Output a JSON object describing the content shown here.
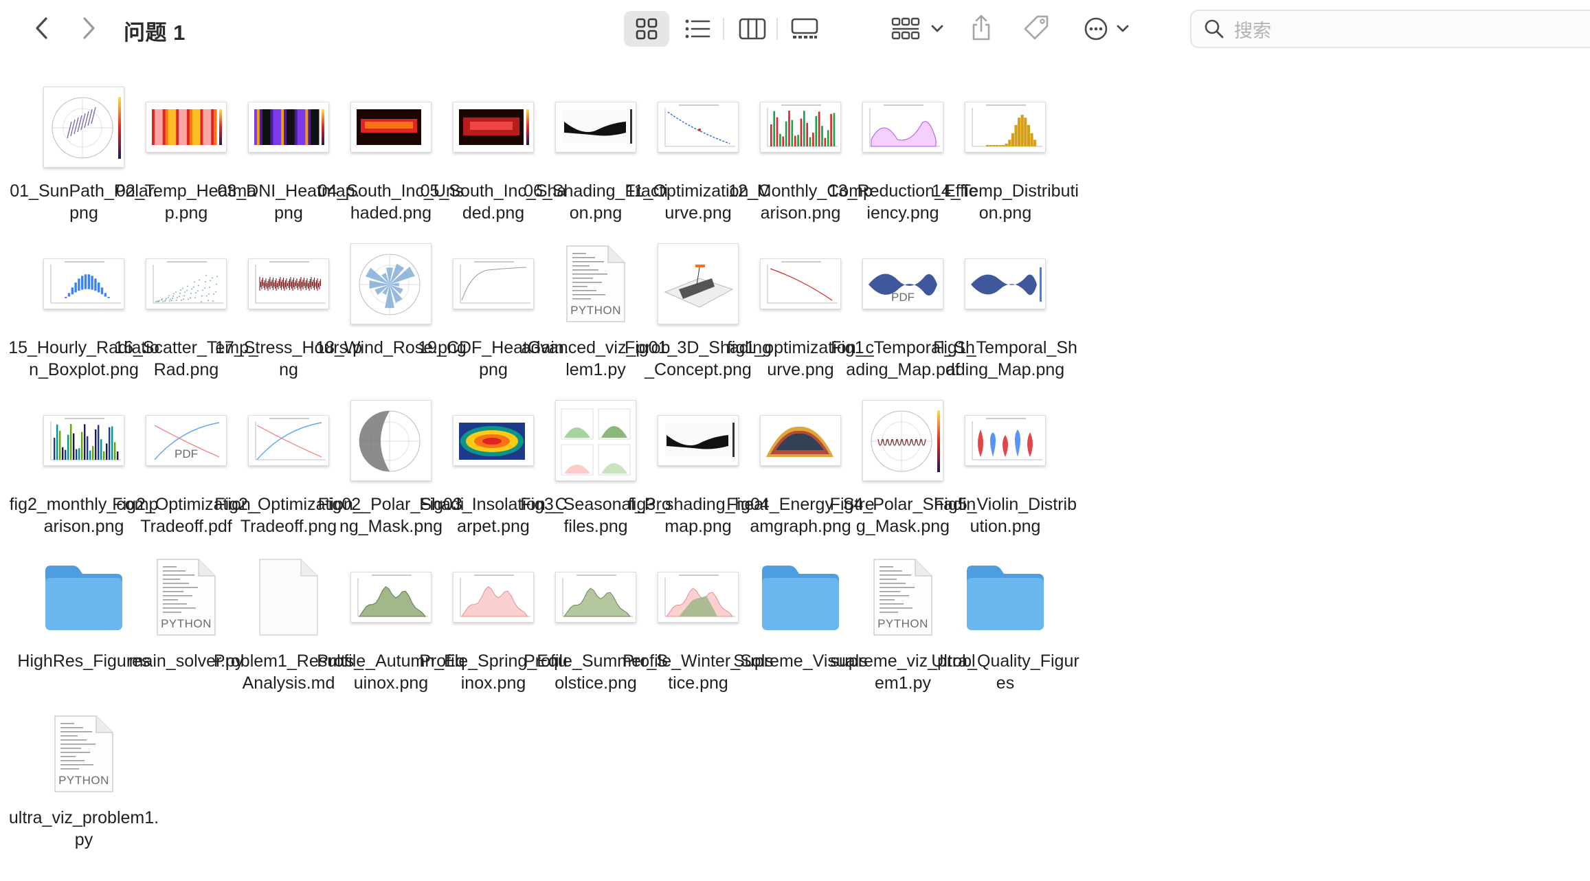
{
  "window": {
    "title": "问题 1",
    "search_placeholder": "搜索"
  },
  "toolbar": {
    "icons": [
      "chevron-left-icon",
      "chevron-right-icon",
      "icon-view-icon",
      "list-view-icon",
      "column-view-icon",
      "gallery-view-icon",
      "group-icon",
      "share-icon",
      "tag-icon",
      "more-icon",
      "search-icon"
    ]
  },
  "colors": {
    "folder": "#5aa9e6",
    "selected_view_bg": "#e6e6e6"
  },
  "files": [
    {
      "name": "01_SunPath_Polar.png",
      "kind": "polar"
    },
    {
      "name": "02_Temp_Heatmap.png",
      "kind": "heat-orange"
    },
    {
      "name": "03_DNI_Heatmap.png",
      "kind": "heat-dark"
    },
    {
      "name": "04_South_Inc_Unshaded.png",
      "kind": "heat-red"
    },
    {
      "name": "05_South_Inc_Shaded.png",
      "kind": "heat-red2"
    },
    {
      "name": "06_Shading_Fraction.png",
      "kind": "shade-black"
    },
    {
      "name": "11_Optimization_Curve.png",
      "kind": "curve-blue"
    },
    {
      "name": "12_Monthly_Comparison.png",
      "kind": "bars-rg"
    },
    {
      "name": "13_Reduction_Efficiency.png",
      "kind": "wave-pink"
    },
    {
      "name": "14_Temp_Distribution.png",
      "kind": "hist-gold"
    },
    {
      "name": "15_Hourly_Radiation_Boxplot.png",
      "kind": "box-blue"
    },
    {
      "name": "16_Scatter_Temp_Rad.png",
      "kind": "scatter"
    },
    {
      "name": "17_Stress_Hours.png",
      "kind": "stress"
    },
    {
      "name": "18_Wind_Rose.png",
      "kind": "rose"
    },
    {
      "name": "19_CDF_HeatGain.png",
      "kind": "cdf"
    },
    {
      "name": "advanced_viz_problem1.py",
      "kind": "python"
    },
    {
      "name": "Fig01_3D_Shading_Concept.png",
      "kind": "3d"
    },
    {
      "name": "fig1_optimization_curve.png",
      "kind": "curve-red"
    },
    {
      "name": "Fig1_Temporal_Shading_Map.pdf",
      "kind": "pdf-blue"
    },
    {
      "name": "Fig1_Temporal_Shading_Map.png",
      "kind": "temporal-blue"
    },
    {
      "name": "fig2_monthly_comparison.png",
      "kind": "bars-multi"
    },
    {
      "name": "Fig2_Optimization_Tradeoff.pdf",
      "kind": "pdf-trade"
    },
    {
      "name": "Fig2_Optimization_Tradeoff.png",
      "kind": "tradeoff"
    },
    {
      "name": "Fig02_Polar_Shading_Mask.png",
      "kind": "polar-mask"
    },
    {
      "name": "Fig03_Insolation_Carpet.png",
      "kind": "carpet"
    },
    {
      "name": "Fig3_Seasonal_Profiles.png",
      "kind": "seasonal"
    },
    {
      "name": "fig3_shading_heatmap.png",
      "kind": "shade-black2"
    },
    {
      "name": "Fig04_Energy_Streamgraph.png",
      "kind": "stream"
    },
    {
      "name": "Fig4_Polar_Shading_Mask.png",
      "kind": "polar4"
    },
    {
      "name": "Fig5_Violin_Distribution.png",
      "kind": "violin"
    },
    {
      "name": "HighRes_Figures",
      "kind": "folder"
    },
    {
      "name": "main_solver.py",
      "kind": "python"
    },
    {
      "name": "Problem1_Results_Analysis.md",
      "kind": "blank"
    },
    {
      "name": "Profile_Autumn_Equinox.png",
      "kind": "profile-green"
    },
    {
      "name": "Profile_Spring_Equinox.png",
      "kind": "profile-pink"
    },
    {
      "name": "Profile_Summer_Solstice.png",
      "kind": "profile-green2"
    },
    {
      "name": "Profile_Winter_Solstice.png",
      "kind": "profile-mixed"
    },
    {
      "name": "Supreme_Visuals",
      "kind": "folder"
    },
    {
      "name": "supreme_viz_problem1.py",
      "kind": "python"
    },
    {
      "name": "Ultra_Quality_Figures",
      "kind": "folder"
    },
    {
      "name": "ultra_viz_problem1.py",
      "kind": "python"
    }
  ],
  "badges": {
    "python": "PYTHON",
    "pdf": "PDF"
  }
}
